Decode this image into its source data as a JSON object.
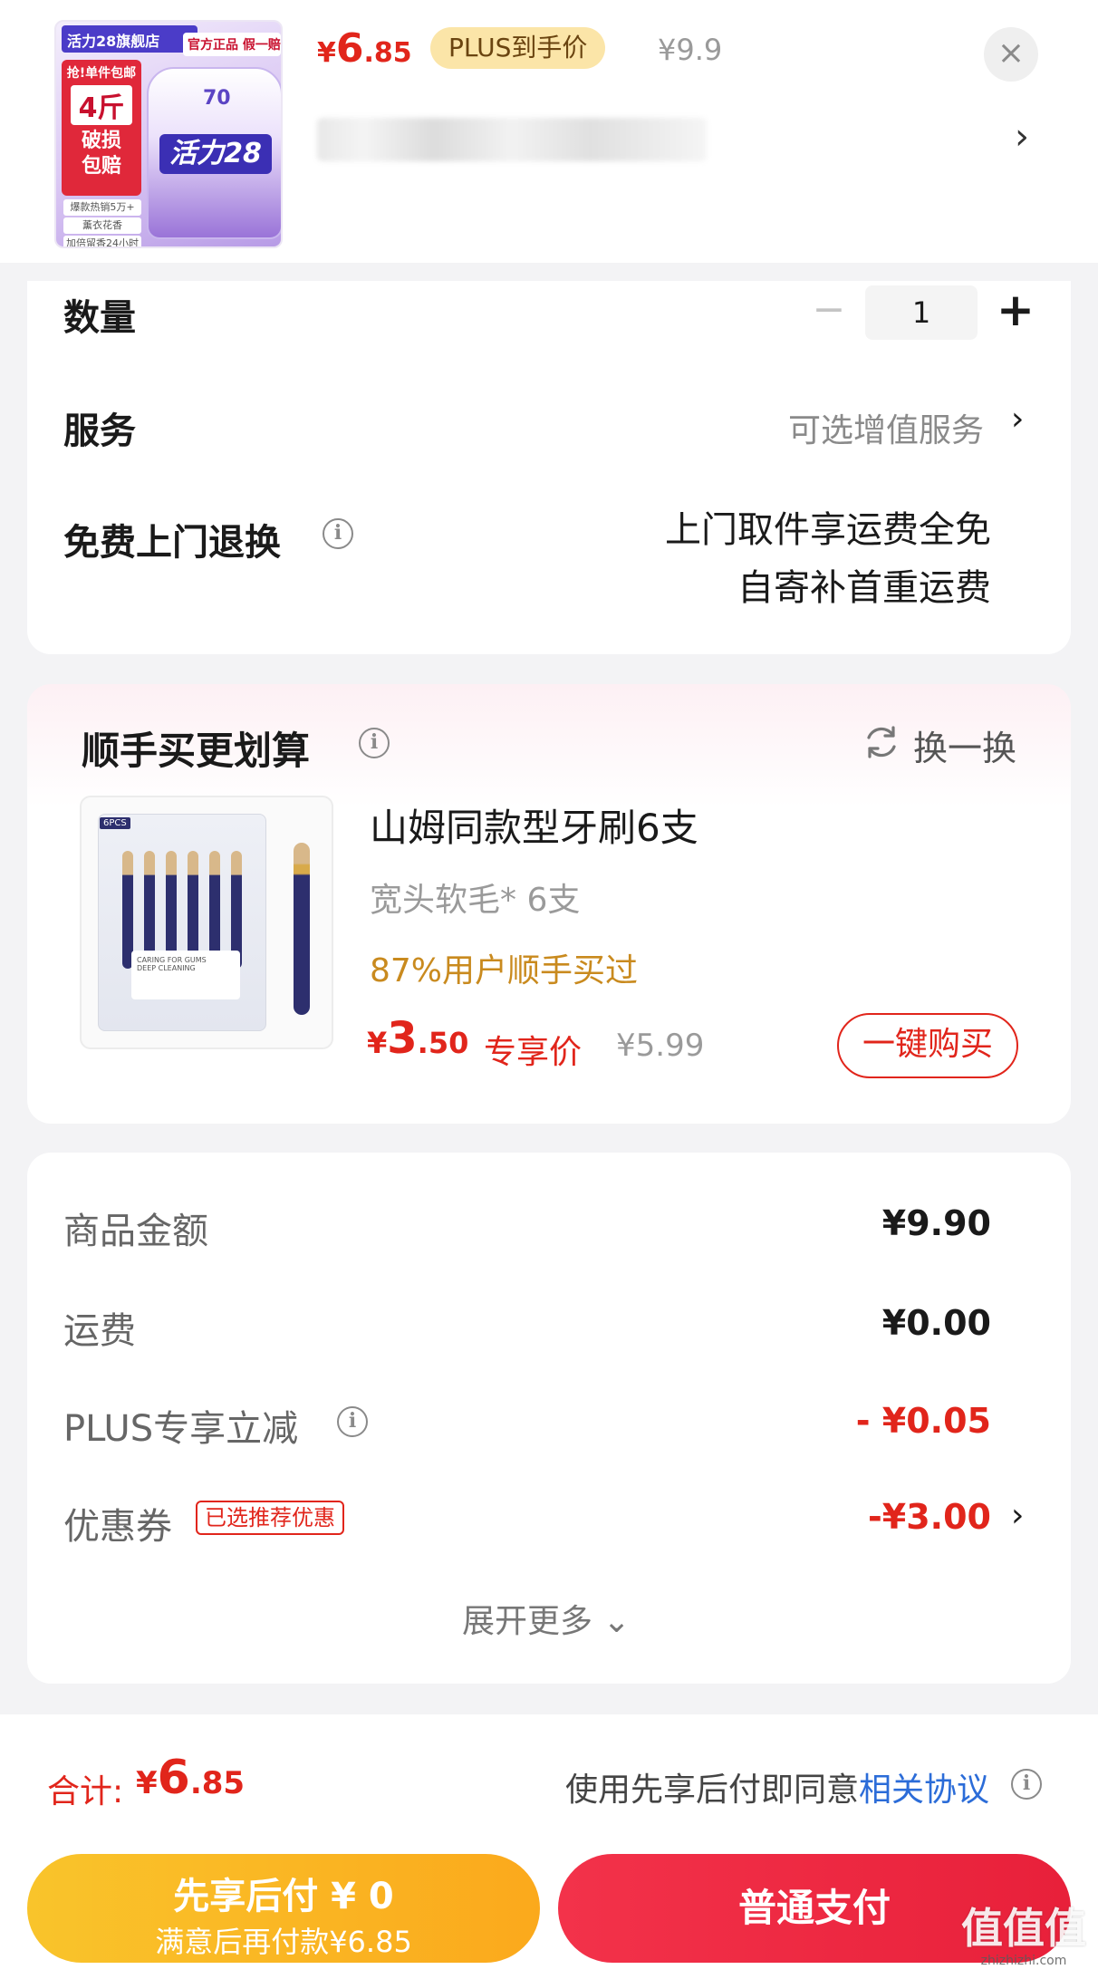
{
  "header": {
    "thumb": {
      "shop_label": "活力28旗舰店",
      "official_label": "官方正品 假一赔十",
      "promo": {
        "line1": "抢!单件包邮",
        "line2": "4斤",
        "line3": "破损",
        "line4": "包赔"
      },
      "brand": "活力28",
      "pct": "70",
      "features": [
        "爆款热销5万+",
        "薰衣花香",
        "加倍留香24小时"
      ]
    },
    "price": {
      "currency": "¥",
      "int": "6",
      "dec": ".85"
    },
    "plus_badge": "PLUS到手价",
    "original_price": "¥9.9",
    "close_icon": "×",
    "chevron": "›"
  },
  "form": {
    "quantity_label": "数量",
    "quantity_value": "1",
    "minus": "−",
    "plus": "+",
    "service_label": "服务",
    "service_value": "可选增值服务",
    "return_label": "免费上门退换",
    "return_line1": "上门取件享运费全免",
    "return_line2": "自寄补首重运费",
    "chevron": "›",
    "info": "i"
  },
  "upsell": {
    "title": "顺手买更划算",
    "refresh_label": "换一换",
    "product_name": "山姆同款型牙刷6支",
    "product_sub": "宽头软毛* 6支",
    "stat": "87%用户顺手买过",
    "price": {
      "currency": "¥",
      "int": "3",
      "dec": ".50"
    },
    "price_tag": "专享价",
    "original_price": "¥5.99",
    "buy_label": "一键购买",
    "image": {
      "pack_tag": "6PCS",
      "label_line1": "CARING FOR GUMS",
      "label_line2": "DEEP CLEANING"
    }
  },
  "summary": {
    "rows": [
      {
        "label": "商品金额",
        "value": "¥9.90"
      },
      {
        "label": "运费",
        "value": "¥0.00"
      },
      {
        "label": "PLUS专享立减",
        "value": "- ¥0.05"
      },
      {
        "label": "优惠券",
        "value": "-¥3.00"
      }
    ],
    "coupon_tag": "已选推荐优惠",
    "expand_label": "展开更多",
    "expand_icon": "⌄"
  },
  "bottom": {
    "total_label": "合计:",
    "total": {
      "currency": "¥",
      "int": "6",
      "dec": ".85"
    },
    "agree_text": "使用先享后付即同意",
    "agree_link": "相关协议",
    "pay_later_line1": "先享后付 ¥ 0",
    "pay_later_line2": "满意后再付款¥6.85",
    "pay_normal": "普通支付"
  },
  "watermark": {
    "main": "值值值",
    "sub": "zhizhizhi.com"
  },
  "colors": {
    "accent_red": "#e1251b",
    "plus_gold": "#fbe5a8",
    "pay_later": "#fba91c",
    "pay_normal": "#e8203a",
    "link_blue": "#2b6cd8"
  }
}
